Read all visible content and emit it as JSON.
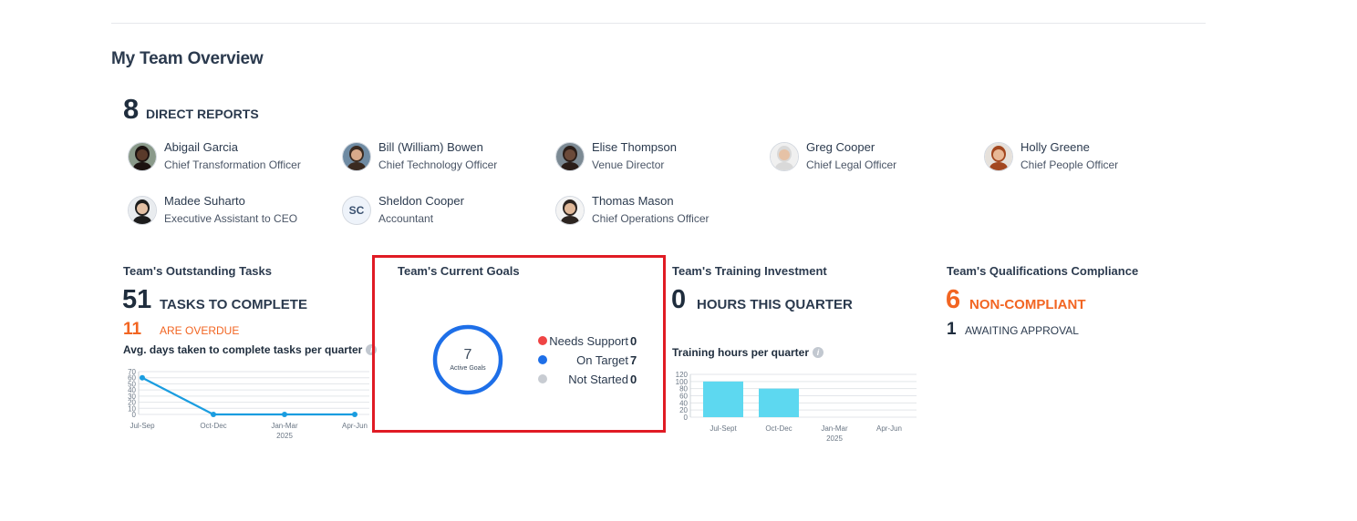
{
  "page": {
    "title": "My Team Overview"
  },
  "direct_reports": {
    "count": "8",
    "label": "DIRECT REPORTS",
    "people": [
      {
        "name": "Abigail Garcia",
        "role": "Chief Transformation Officer",
        "avatar": "photo"
      },
      {
        "name": "Bill (William) Bowen",
        "role": "Chief Technology Officer",
        "avatar": "photo"
      },
      {
        "name": "Elise Thompson",
        "role": "Venue Director",
        "avatar": "photo"
      },
      {
        "name": "Greg Cooper",
        "role": "Chief Legal Officer",
        "avatar": "photo"
      },
      {
        "name": "Holly Greene",
        "role": "Chief People Officer",
        "avatar": "photo"
      },
      {
        "name": "Madee Suharto",
        "role": "Executive Assistant to CEO",
        "avatar": "photo"
      },
      {
        "name": "Sheldon Cooper",
        "role": "Accountant",
        "avatar": "initials",
        "initials": "SC"
      },
      {
        "name": "Thomas Mason",
        "role": "Chief Operations Officer",
        "avatar": "photo"
      }
    ]
  },
  "tasks": {
    "title": "Team's Outstanding Tasks",
    "count": "51",
    "label": "TASKS TO COMPLETE",
    "overdue_count": "11",
    "overdue_label": "ARE OVERDUE",
    "chart_caption": "Avg. days taken to complete tasks per quarter"
  },
  "goals": {
    "title": "Team's Current Goals",
    "active_count": "7",
    "active_label": "Active Goals",
    "legend": [
      {
        "label": "Needs Support",
        "value": "0",
        "color": "#ef4444"
      },
      {
        "label": "On Target",
        "value": "7",
        "color": "#1e6fe8"
      },
      {
        "label": "Not Started",
        "value": "0",
        "color": "#c8ccd2"
      }
    ]
  },
  "training": {
    "title": "Team's Training Investment",
    "count": "0",
    "label": "HOURS THIS QUARTER",
    "chart_caption": "Training hours per quarter"
  },
  "qualifications": {
    "title": "Team's Qualifications Compliance",
    "noncompliant_count": "6",
    "noncompliant_label": "NON-COMPLIANT",
    "awaiting_count": "1",
    "awaiting_label": "AWAITING APPROVAL"
  },
  "chart_data": [
    {
      "type": "line",
      "categories": [
        "Jul-Sep",
        "Oct-Dec",
        "Jan-Mar",
        "Apr-Jun"
      ],
      "category_sublabels": [
        "",
        "",
        "2025",
        ""
      ],
      "values": [
        60,
        0,
        0,
        0
      ],
      "ylim": [
        0,
        70
      ],
      "yticks": [
        "70",
        "60",
        "50",
        "40",
        "30",
        "20",
        "10",
        "0"
      ],
      "grid": true,
      "color": "#1a9de0"
    },
    {
      "type": "bar",
      "categories": [
        "Jul-Sept",
        "Oct-Dec",
        "Jan-Mar",
        "Apr-Jun"
      ],
      "category_sublabels": [
        "",
        "",
        "2025",
        ""
      ],
      "values": [
        100,
        80,
        0,
        0
      ],
      "ylim": [
        0,
        120
      ],
      "yticks": [
        "120",
        "100",
        "80",
        "60",
        "40",
        "20",
        "0"
      ],
      "grid": true,
      "color": "#5dd8f0"
    },
    {
      "type": "pie",
      "categories": [
        "Needs Support",
        "On Target",
        "Not Started"
      ],
      "values": [
        0,
        7,
        0
      ],
      "colors": [
        "#ef4444",
        "#1e6fe8",
        "#c8ccd2"
      ]
    }
  ]
}
